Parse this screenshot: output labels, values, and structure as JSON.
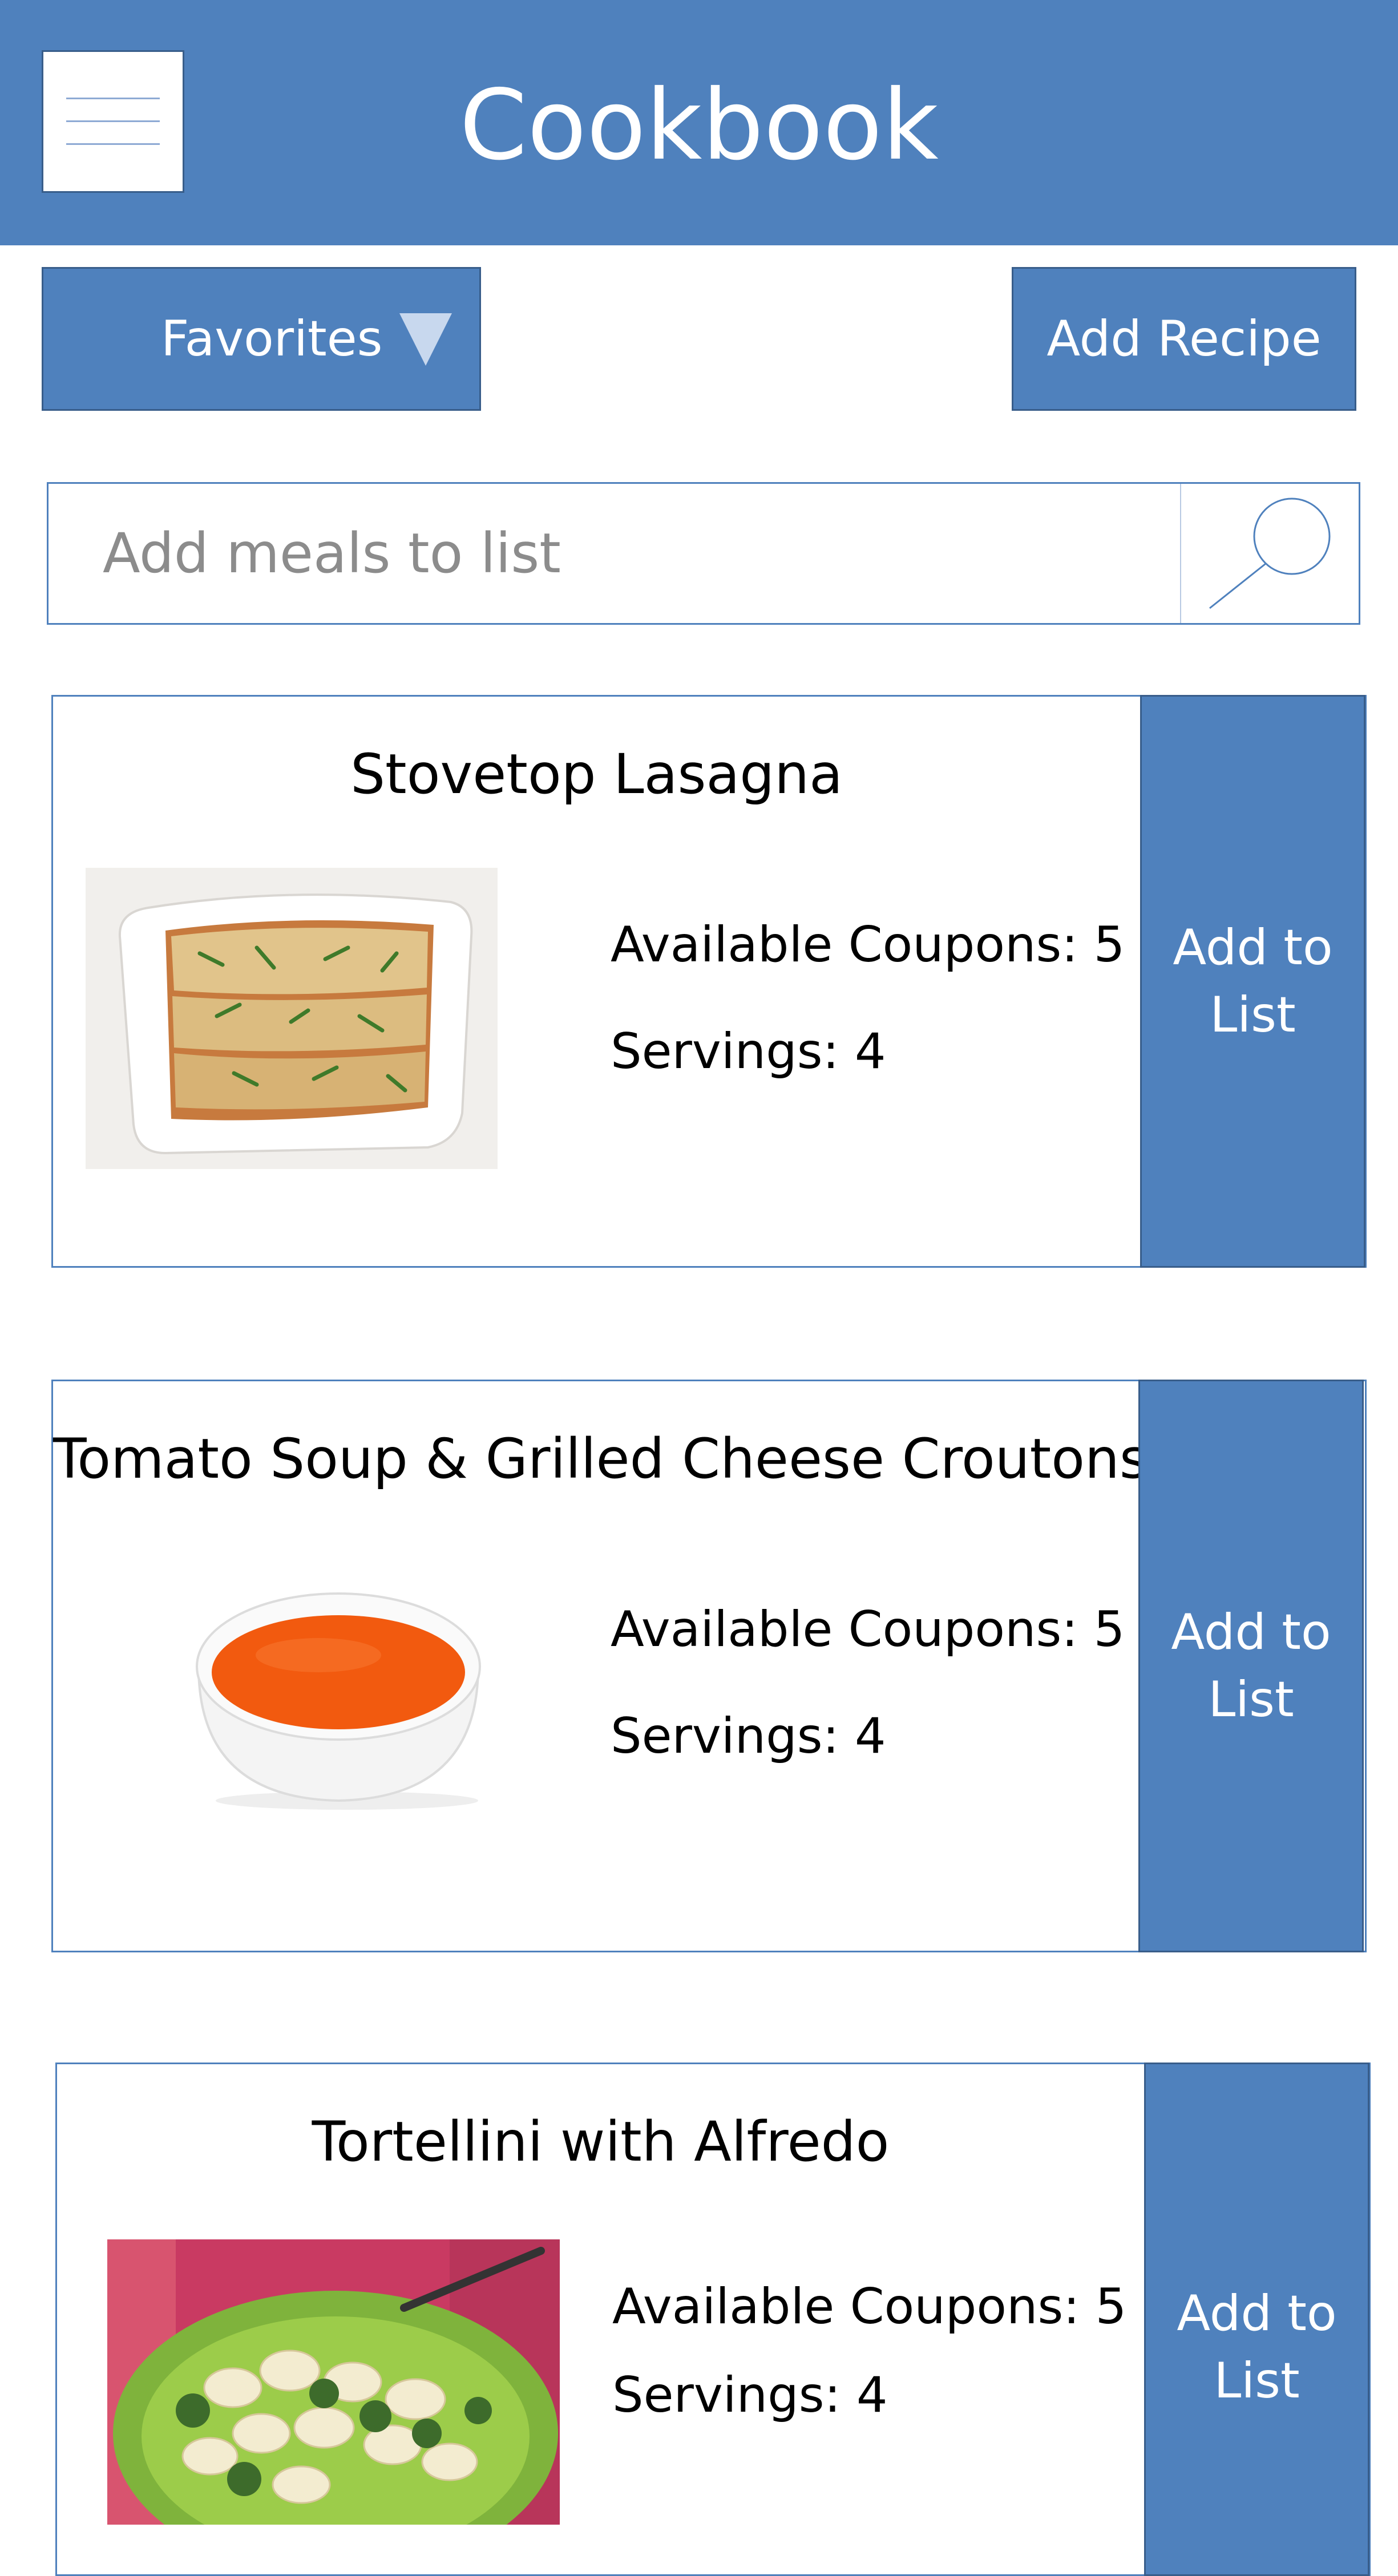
{
  "header": {
    "title": "Cookbook",
    "menu_icon": "hamburger-menu-icon"
  },
  "toolbar": {
    "filter_label": "Favorites",
    "add_recipe_label": "Add Recipe"
  },
  "search": {
    "placeholder": "Add meals to list",
    "value": "",
    "icon": "search-icon"
  },
  "recipes": [
    {
      "title": "Stovetop Lasagna",
      "image": "lasagna-photo",
      "coupons_label": "Available Coupons: 5",
      "servings_label": "Servings: 4",
      "action_label": "Add to List"
    },
    {
      "title": "Tomato Soup & Grilled Cheese Croutons",
      "image": "tomato-soup-photo",
      "coupons_label": "Available Coupons: 5",
      "servings_label": "Servings: 4",
      "action_label": "Add to List"
    },
    {
      "title": "Tortellini with Alfredo",
      "image": "tortellini-photo",
      "coupons_label": "Available Coupons: 5",
      "servings_label": "Servings: 4",
      "action_label": "Add to List"
    }
  ],
  "colors": {
    "primary": "#4f81bd",
    "primary_border": "#385d8a",
    "background": "#ffffff"
  }
}
